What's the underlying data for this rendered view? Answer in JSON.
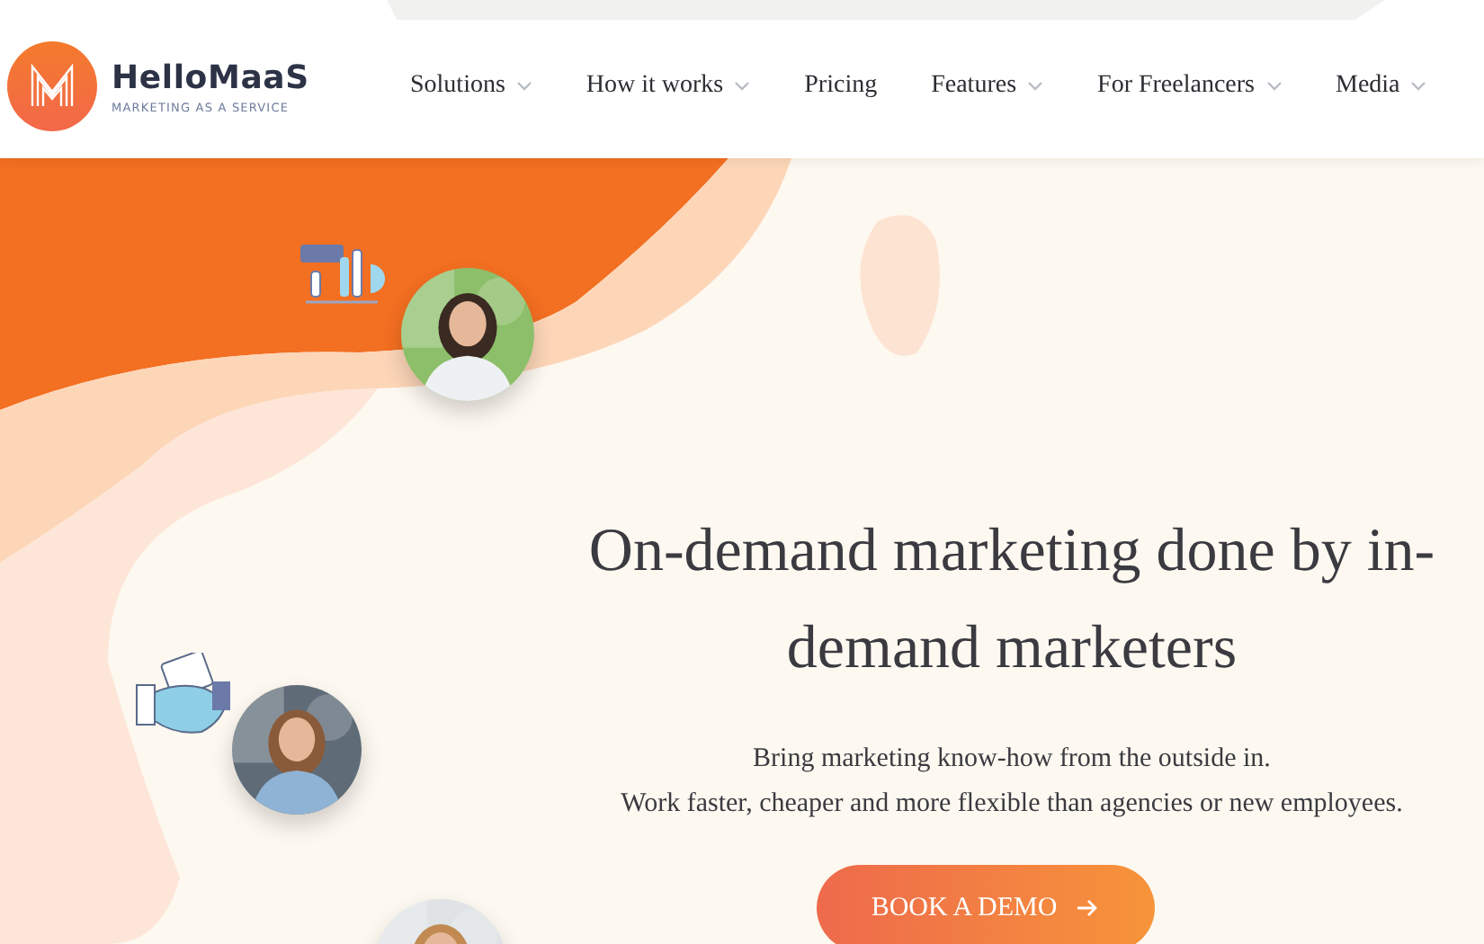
{
  "brand": {
    "name": "HelloMaaS",
    "tagline": "MARKETING AS A SERVICE"
  },
  "nav": [
    {
      "label": "Solutions",
      "has_dropdown": true
    },
    {
      "label": "How it works",
      "has_dropdown": true
    },
    {
      "label": "Pricing",
      "has_dropdown": false
    },
    {
      "label": "Features",
      "has_dropdown": true
    },
    {
      "label": "For Freelancers",
      "has_dropdown": true
    },
    {
      "label": "Media",
      "has_dropdown": true
    }
  ],
  "hero": {
    "title": "On-demand marketing done by in-demand marketers",
    "lines": [
      "Bring marketing know-how from the outside in.",
      "Work faster, cheaper and more flexible than agencies or new employees."
    ],
    "button": "BOOK A DEMO"
  }
}
